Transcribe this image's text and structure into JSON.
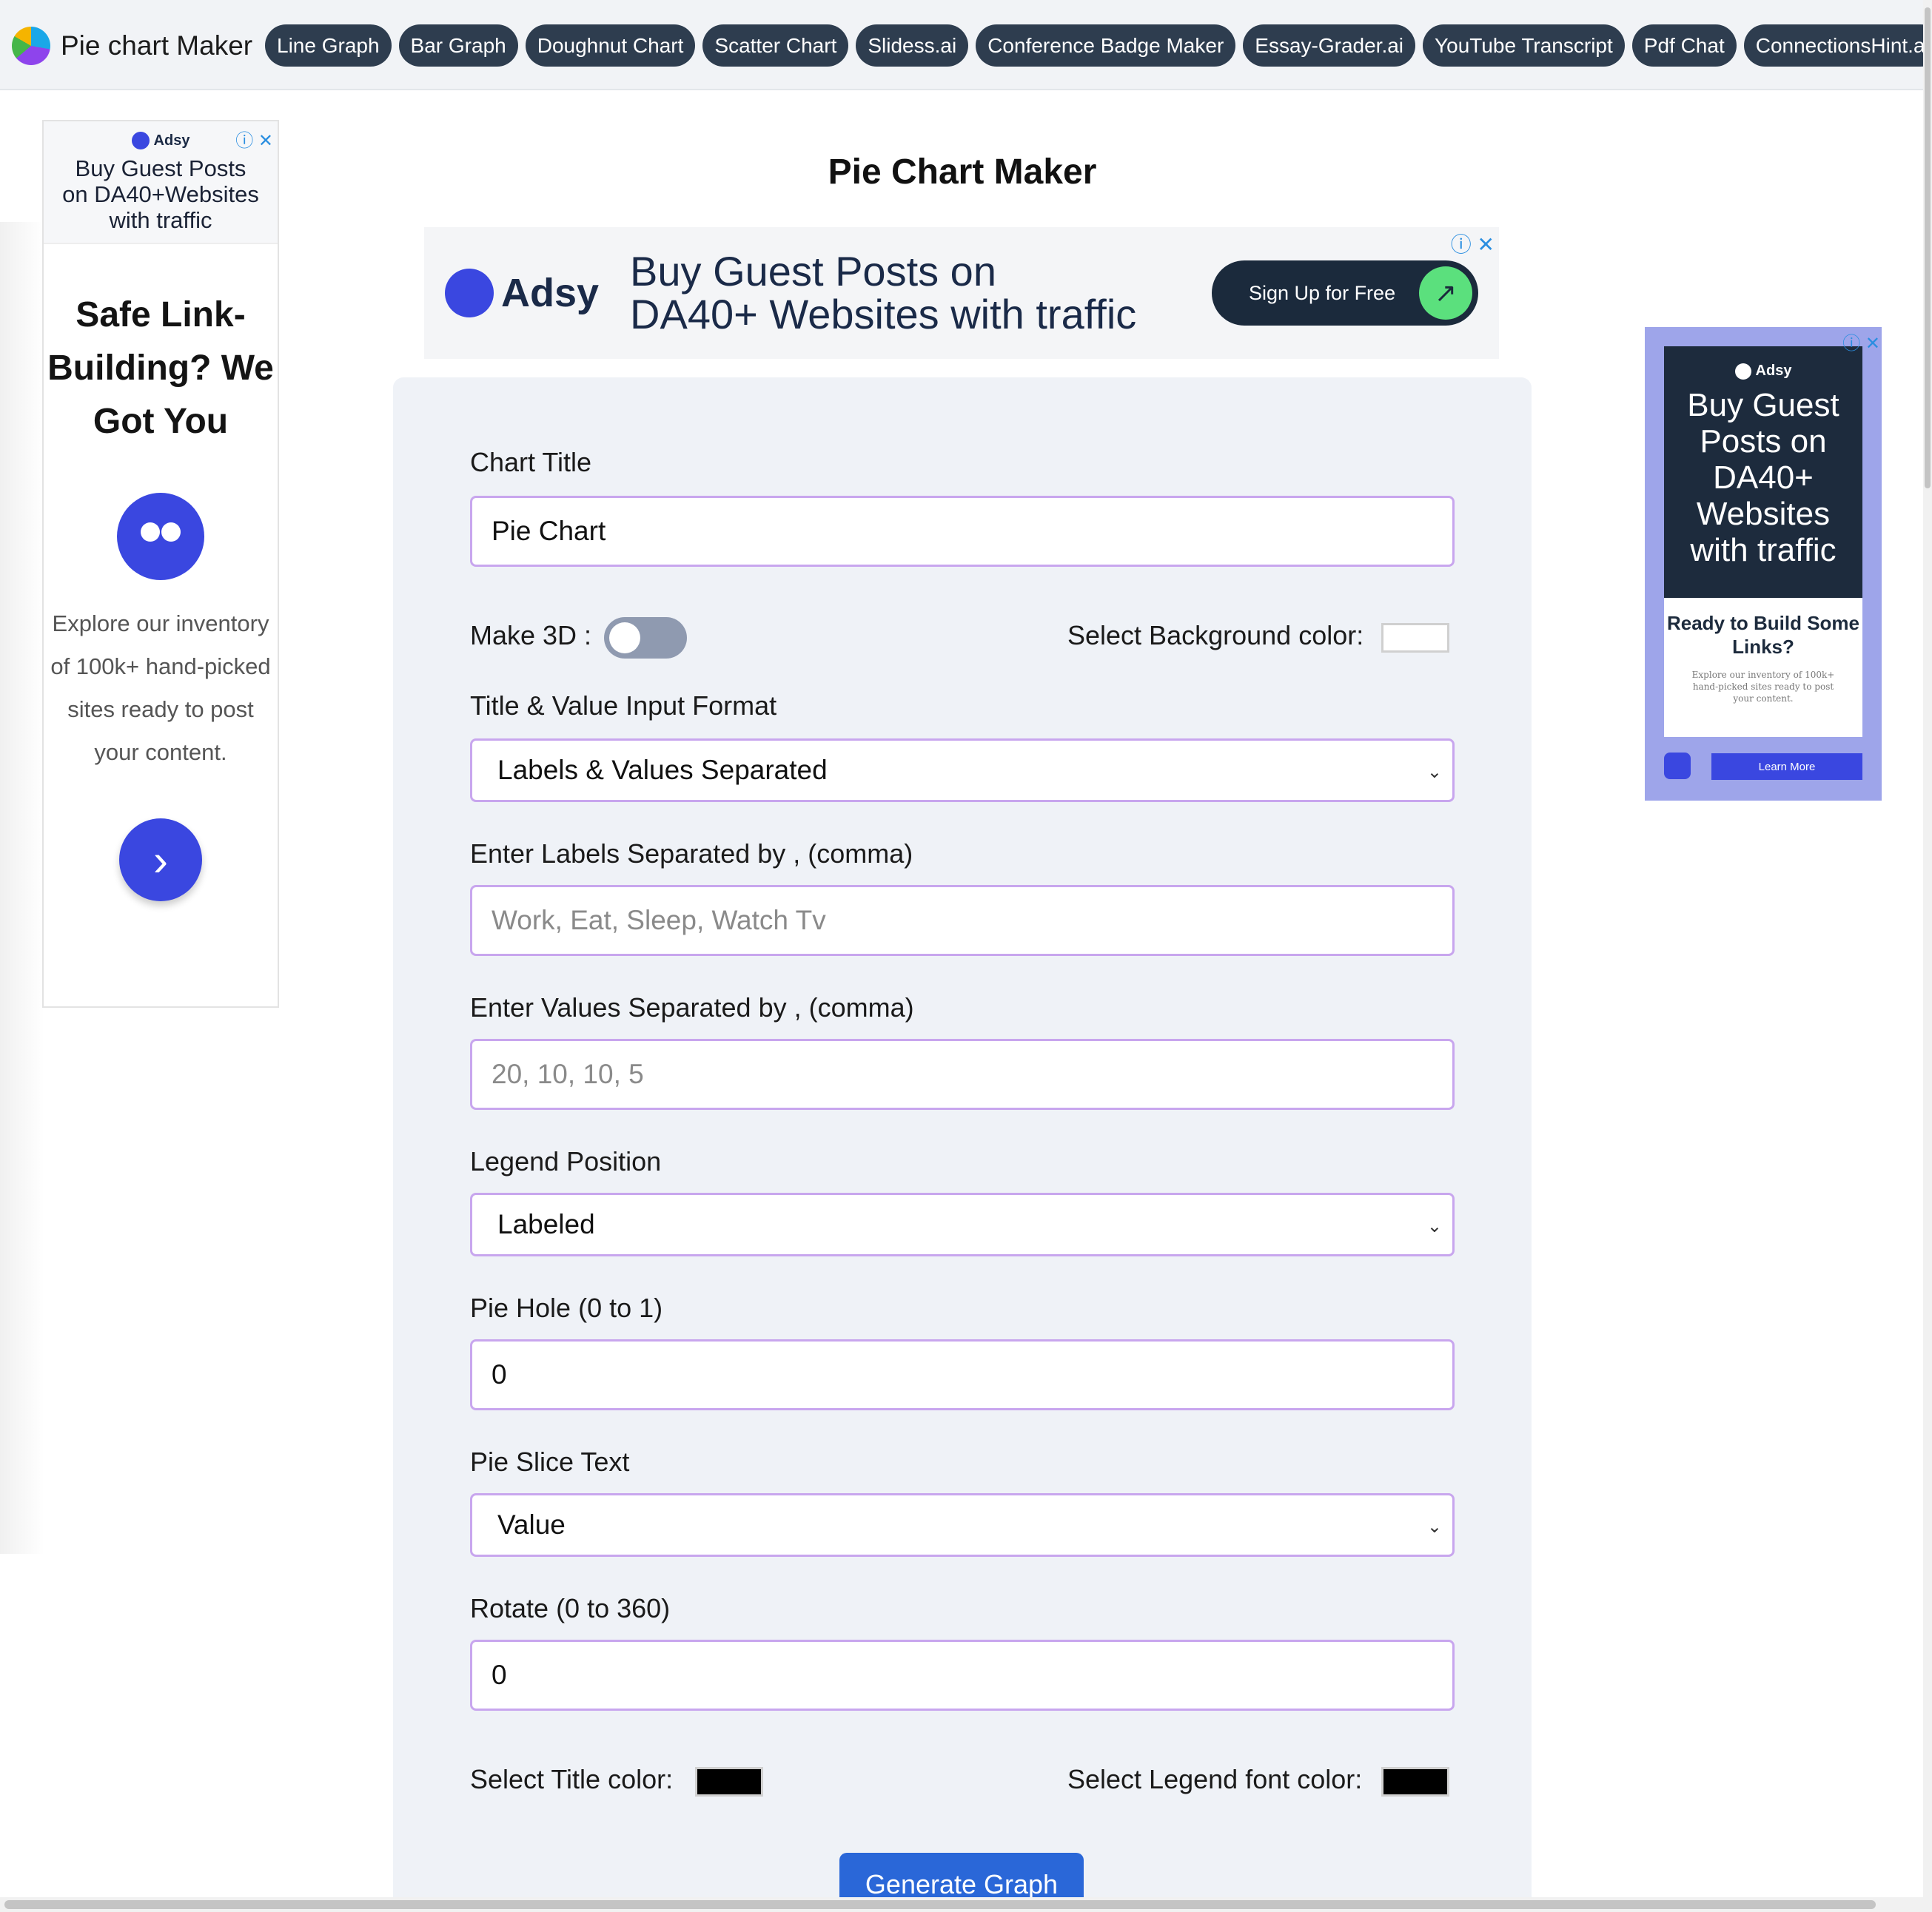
{
  "nav": {
    "brand": "Pie chart Maker",
    "links": [
      "Line Graph",
      "Bar Graph",
      "Doughnut Chart",
      "Scatter Chart",
      "Slidess.ai",
      "Conference Badge Maker",
      "Essay-Grader.ai",
      "YouTube Transcript",
      "Pdf Chat",
      "ConnectionsHint.ai"
    ]
  },
  "page": {
    "title": "Pie Chart Maker"
  },
  "ads": {
    "left": {
      "brand": "Adsy",
      "top_copy_1": "Buy Guest Posts",
      "top_copy_2": "on DA40+Websites",
      "top_copy_3": "with traffic",
      "headline": "Safe Link-Building? We Got You",
      "desc": "Explore our inventory of 100k+ hand-picked sites ready to post your content.",
      "arrow": "›",
      "close": "ⓘ ✕"
    },
    "banner": {
      "brand": "Adsy",
      "line1": "Buy Guest Posts on",
      "line2": "DA40+ Websites with traffic",
      "cta": "Sign Up for Free",
      "go": "↗",
      "close": "ⓘ ✕"
    },
    "right": {
      "brand": "Adsy",
      "big": "Buy Guest Posts on DA40+ Websites with traffic",
      "card_title": "Ready to Build Some Links?",
      "card_text": "Explore our inventory of 100k+ hand-picked sites ready to post your content.",
      "learn": "Learn More",
      "close": "ⓘ ✕"
    }
  },
  "form": {
    "chart_title_label": "Chart Title",
    "chart_title_value": "Pie Chart",
    "make3d_label": "Make 3D :",
    "bg_color_label": "Select Background color:",
    "bg_color": "#ffffff",
    "format_label": "Title & Value Input Format",
    "format_value": "Labels & Values Separated",
    "labels_label": "Enter Labels Separated by , (comma)",
    "labels_placeholder": "Work, Eat, Sleep, Watch Tv",
    "values_label": "Enter Values Separated by , (comma)",
    "values_placeholder": "20, 10, 10, 5",
    "legend_label": "Legend Position",
    "legend_value": "Labeled",
    "piehole_label": "Pie Hole (0 to 1)",
    "piehole_value": "0",
    "slice_text_label": "Pie Slice Text",
    "slice_text_value": "Value",
    "rotate_label": "Rotate (0 to 360)",
    "rotate_value": "0",
    "title_color_label": "Select Title color:",
    "title_color": "#000000",
    "legend_color_label": "Select Legend font color:",
    "legend_color": "#000000",
    "generate": "Generate Graph"
  },
  "colors": {
    "nav_pill": "#2e3d4f",
    "field_border": "#c8a6ee",
    "primary_button": "#2a67d8",
    "ad_blue": "#3a47e0"
  }
}
